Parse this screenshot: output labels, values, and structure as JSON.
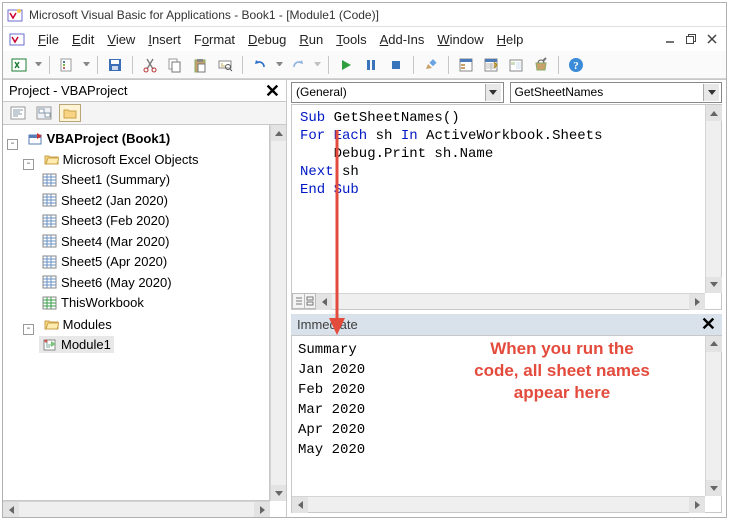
{
  "window": {
    "title": "Microsoft Visual Basic for Applications - Book1 - [Module1 (Code)]"
  },
  "menu": {
    "file": "File",
    "edit": "Edit",
    "view": "View",
    "insert": "Insert",
    "format": "Format",
    "debug": "Debug",
    "run": "Run",
    "tools": "Tools",
    "addins": "Add-Ins",
    "window": "Window",
    "help": "Help"
  },
  "projectPane": {
    "title": "Project - VBAProject",
    "root": "VBAProject (Book1)",
    "excelObjects": {
      "label": "Microsoft Excel Objects",
      "items": [
        "Sheet1 (Summary)",
        "Sheet2 (Jan 2020)",
        "Sheet3 (Feb 2020)",
        "Sheet4 (Mar 2020)",
        "Sheet5 (Apr 2020)",
        "Sheet6 (May 2020)",
        "ThisWorkbook"
      ]
    },
    "modules": {
      "label": "Modules",
      "items": [
        "Module1"
      ]
    }
  },
  "code": {
    "objectCombo": "(General)",
    "procCombo": "GetSheetNames",
    "line1a": "Sub",
    "line1b": " GetSheetNames()",
    "line2a": "For Each",
    "line2b": " sh ",
    "line2c": "In",
    "line2d": " ActiveWorkbook.Sheets",
    "line3": "    Debug.Print sh.Name",
    "line4a": "Next",
    "line4b": " sh",
    "line5": "End Sub"
  },
  "immediate": {
    "title": "Immediate",
    "lines": [
      "Summary",
      "Jan 2020",
      "Feb 2020",
      "Mar 2020",
      "Apr 2020",
      "May 2020"
    ]
  },
  "annotation": {
    "text1": "When you run the",
    "text2": "code, all sheet names",
    "text3": "appear here"
  }
}
